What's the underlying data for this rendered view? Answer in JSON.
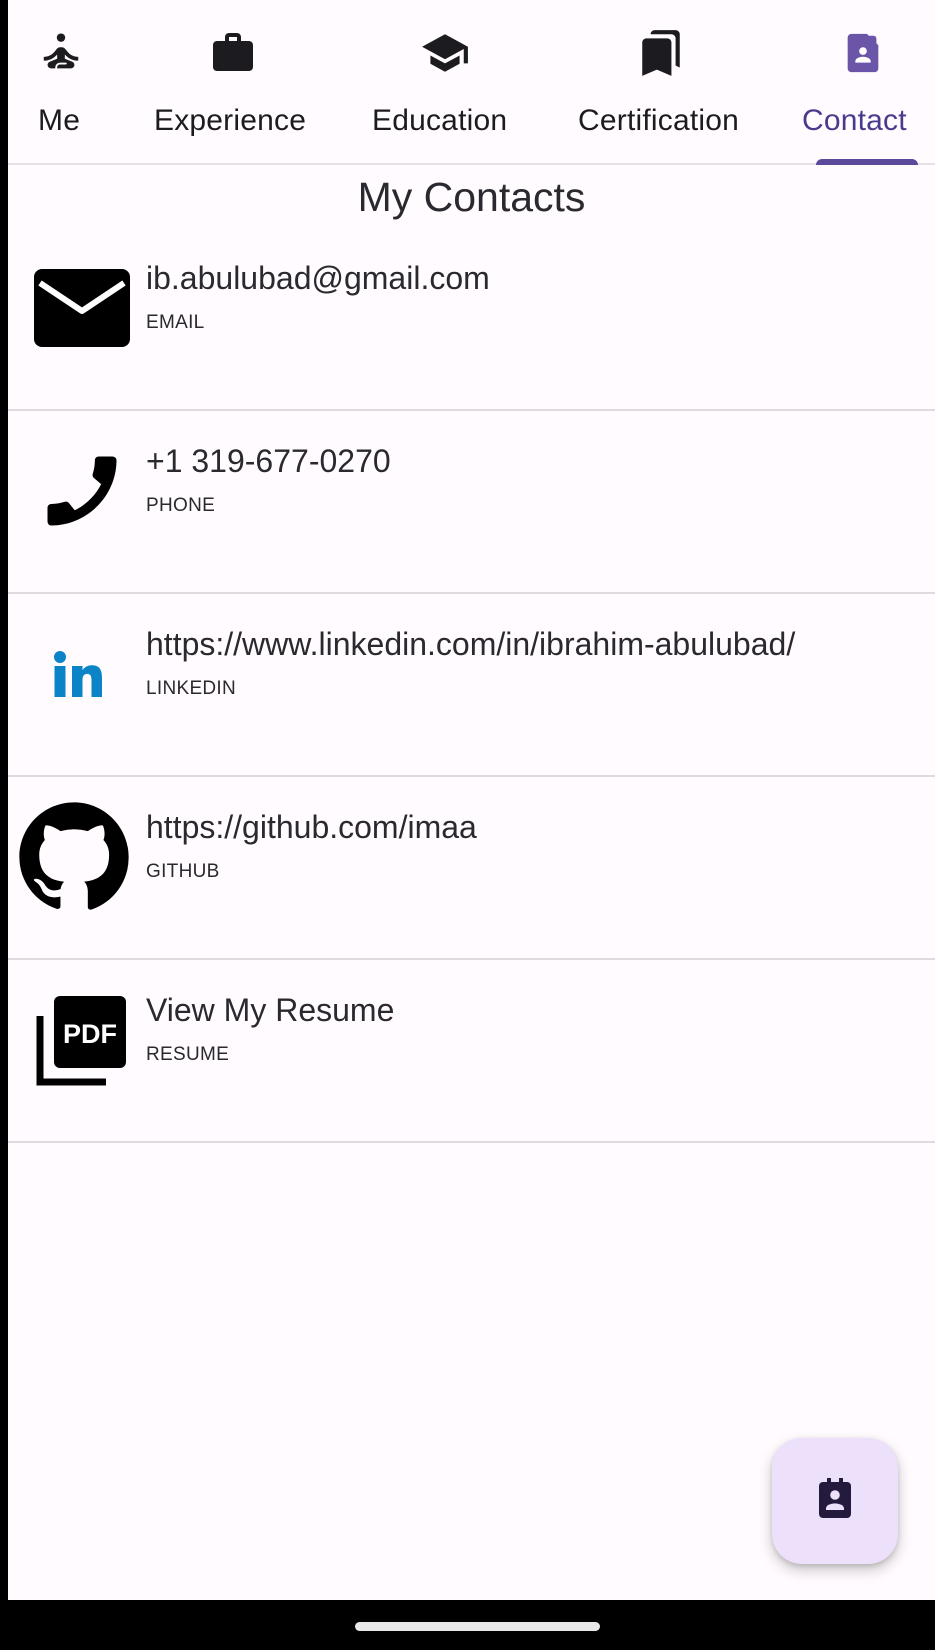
{
  "tabs": [
    {
      "label": "Me",
      "icon": "meditation-icon"
    },
    {
      "label": "Experience",
      "icon": "briefcase-icon"
    },
    {
      "label": "Education",
      "icon": "graduation-cap-icon"
    },
    {
      "label": "Certification",
      "icon": "bookmarks-icon"
    },
    {
      "label": "Contact",
      "icon": "contact-page-icon",
      "active": true
    }
  ],
  "page": {
    "title": "My Contacts"
  },
  "contacts": [
    {
      "value": "ib.abulubad@gmail.com",
      "type": "EMAIL",
      "icon": "email-icon"
    },
    {
      "value": "+1 319-677-0270",
      "type": "PHONE",
      "icon": "phone-icon"
    },
    {
      "value": "https://www.linkedin.com/in/ibrahim-abulubad/",
      "type": "LINKEDIN",
      "icon": "linkedin-icon"
    },
    {
      "value": "https://github.com/imaa",
      "type": "GITHUB",
      "icon": "github-icon"
    },
    {
      "value": "View My Resume",
      "type": "RESUME",
      "icon": "pdf-icon"
    }
  ],
  "fab": {
    "icon": "contact-page-icon"
  },
  "colors": {
    "accent": "#5b4a9c",
    "active_label": "#4a3a8c",
    "fab_background": "#ece0fb",
    "linkedin_blue": "#0a84c6",
    "background": "#fffbfe"
  }
}
